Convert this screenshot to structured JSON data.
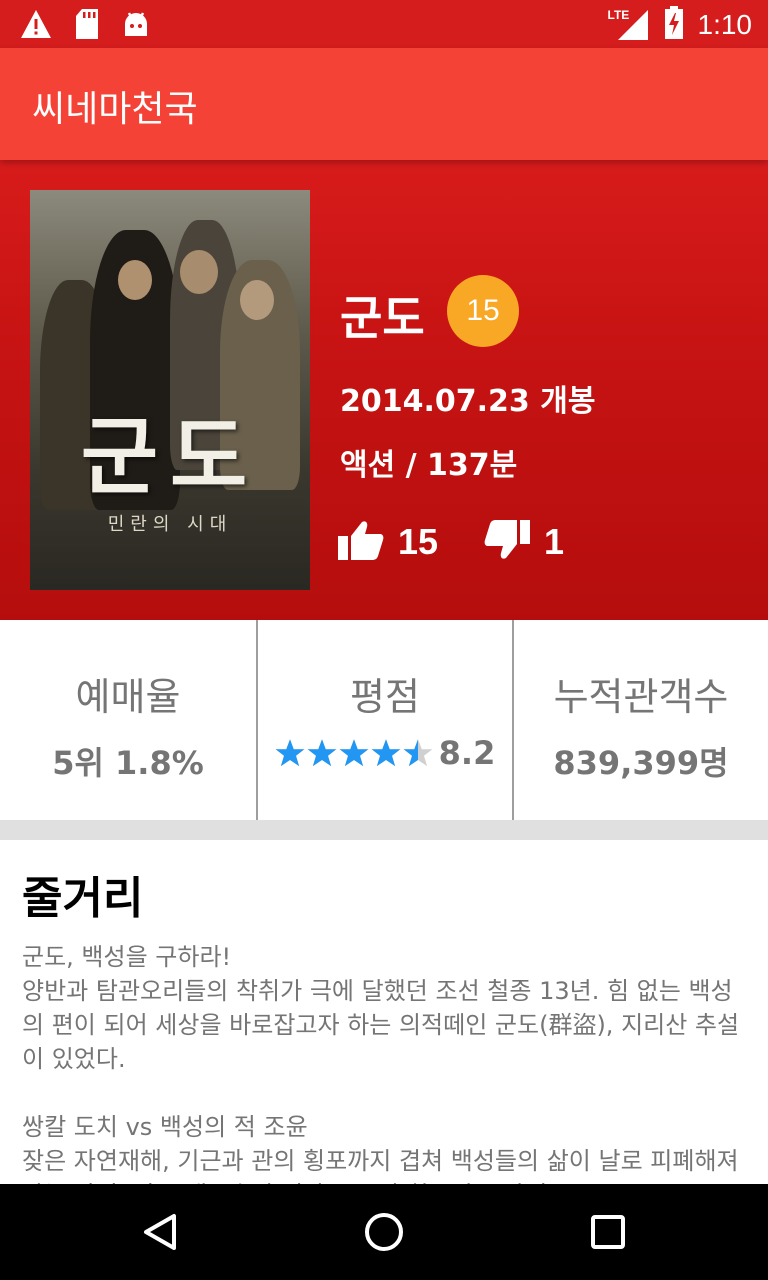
{
  "status_bar": {
    "time": "1:10",
    "network": "LTE",
    "icons": [
      "warning-icon",
      "sd-card-icon",
      "android-icon",
      "lte-signal-icon",
      "battery-charging-icon"
    ]
  },
  "app_bar": {
    "title": "씨네마천국"
  },
  "movie": {
    "poster_title": "군도",
    "poster_subtitle": "민란의 시대",
    "title": "군도",
    "grade": "15",
    "release": "2014.07.23 개봉",
    "genre_runtime": "액션 / 137분",
    "likes": "15",
    "dislikes": "1"
  },
  "stats": {
    "reservation": {
      "label": "예매율",
      "value": "5위 1.8%"
    },
    "rating": {
      "label": "평점",
      "value": "8.2",
      "stars": 4.5,
      "max_stars": 5
    },
    "audience": {
      "label": "누적관객수",
      "value": "839,399명"
    }
  },
  "synopsis": {
    "title": "줄거리",
    "body": "군도, 백성을 구하라!\n양반과 탐관오리들의 착취가 극에 달했던 조선 철종 13년. 힘 없는 백성의 편이 되어 세상을 바로잡고자 하는 의적떼인 군도(群盜), 지리산 추설이 있었다.\n\n쌍칼 도치 vs 백성의 적 조윤\n잦은 자연재해, 기근과 관의 횡포까지 겹쳐 백성들의 삶이 날로 피폐해져 가는 사이, 남도 대부호의 서자로 조선 최고의 무관 출"
  },
  "colors": {
    "status_bar": "#d51d1d",
    "app_bar": "#f44336",
    "hero": "#c71313",
    "grade_badge": "#f9a825",
    "star": "#2196f3",
    "star_empty": "#d0d0d0",
    "stat_text": "#757575"
  }
}
